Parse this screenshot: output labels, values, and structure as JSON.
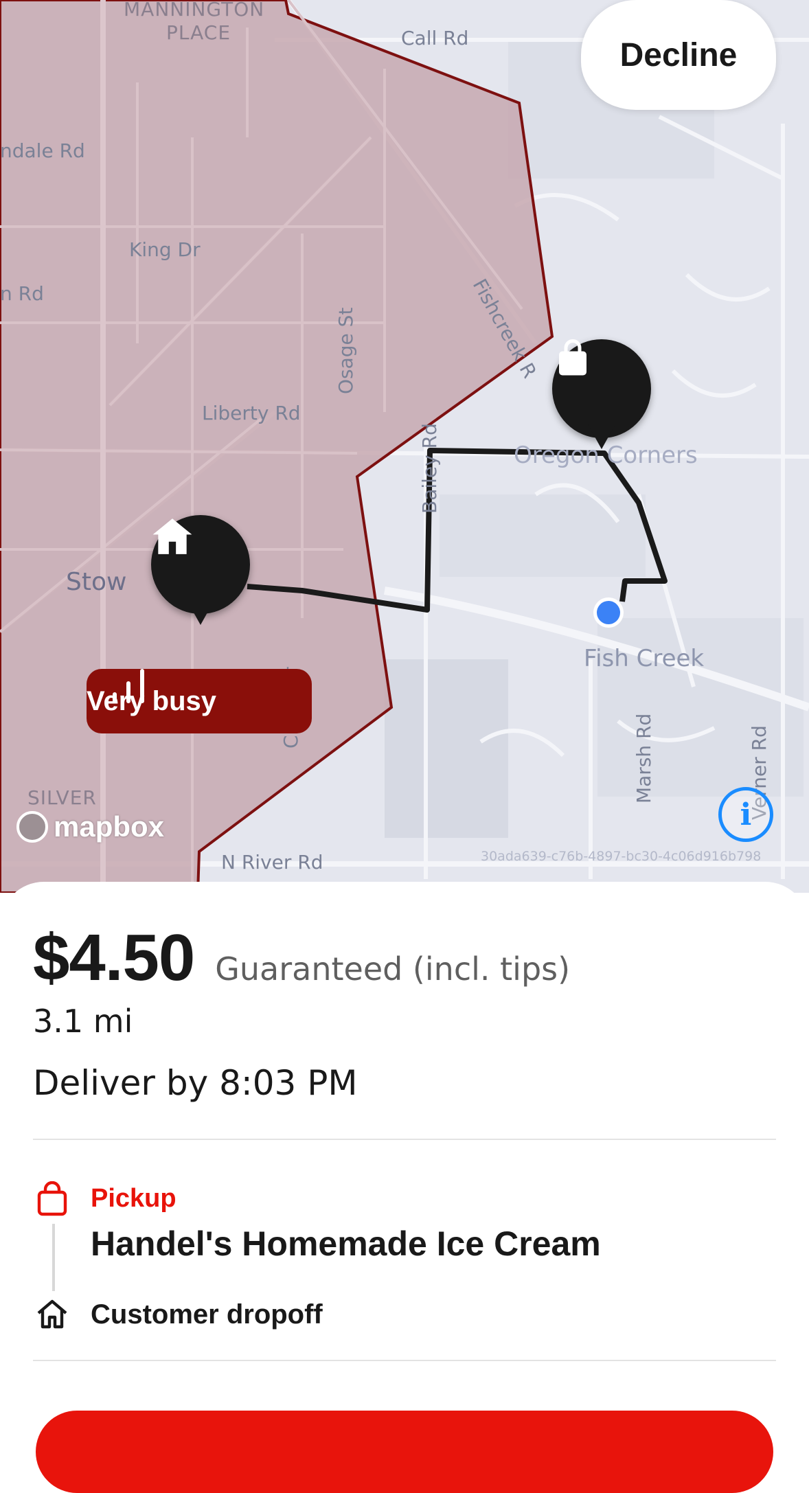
{
  "map": {
    "labels": {
      "manning_place_1": "MANNINGTON",
      "manning_place_2": "PLACE",
      "call_rd": "Call Rd",
      "ndale_rd": "ndale Rd",
      "king_dr": "King Dr",
      "n_rd": "n Rd",
      "osage_st": "Osage St",
      "fishcreek_rd": "Fishcreek R",
      "liberty_rd": "Liberty Rd",
      "oregon_corners": "Oregon Corners",
      "stow": "Stow",
      "fish_creek": "Fish Creek",
      "cross_dr": "Cross Dr",
      "marsh_rd": "Marsh Rd",
      "verner_rd": "Verner Rd",
      "silver": "SILVER",
      "n_river_rd": "N River Rd",
      "bailey_rd": "Bailey Rd"
    },
    "decline_label": "Decline",
    "busy_label": "Very busy",
    "mapbox_label": "mapbox",
    "info_label": "i",
    "map_id": "30ada639-c76b-4897-bc30-4c06d916b798",
    "busy_zone_color": "#8a0f0a",
    "current_location_color": "#3b82f6"
  },
  "offer": {
    "price": "$4.50",
    "price_note": "Guaranteed (incl. tips)",
    "distance": "3.1 mi",
    "deliver_by": "Deliver by 8:03 PM",
    "pickup_label": "Pickup",
    "store_name": "Handel's Homemade Ice Cream",
    "dropoff_label": "Customer dropoff",
    "accent_color": "#e8140c"
  }
}
